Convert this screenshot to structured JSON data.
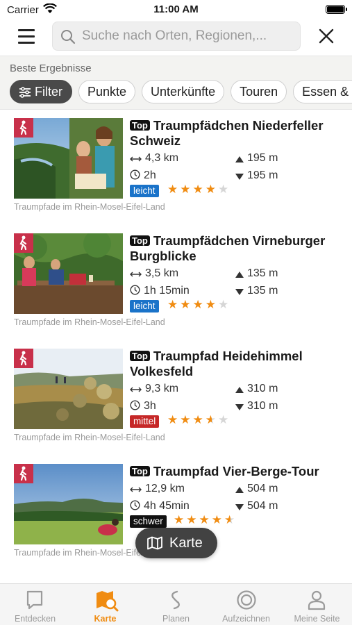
{
  "status": {
    "carrier": "Carrier",
    "time": "11:00 AM"
  },
  "search": {
    "placeholder": "Suche nach Orten, Regionen,..."
  },
  "filters": {
    "section_label": "Beste Ergebnisse",
    "chips": [
      "Filter",
      "Punkte",
      "Unterkünfte",
      "Touren",
      "Essen & Trinken"
    ]
  },
  "results": [
    {
      "title": "Traumpfädchen Niederfeller Schweiz",
      "top": "Top",
      "distance": "4,3 km",
      "duration": "2h",
      "ascent": "195 m",
      "descent": "195 m",
      "difficulty": "leicht",
      "difficulty_color": "#1a73c9",
      "rating": 4,
      "region": "Traumpfade im Rhein-Mosel-Eifel-Land"
    },
    {
      "title": "Traumpfädchen Virneburger Burgblicke",
      "top": "Top",
      "distance": "3,5 km",
      "duration": "1h 15min",
      "ascent": "135 m",
      "descent": "135 m",
      "difficulty": "leicht",
      "difficulty_color": "#1a73c9",
      "rating": 4,
      "region": "Traumpfade im Rhein-Mosel-Eifel-Land"
    },
    {
      "title": "Traumpfad Heidehimmel Volkesfeld",
      "top": "Top",
      "distance": "9,3 km",
      "duration": "3h",
      "ascent": "310 m",
      "descent": "310 m",
      "difficulty": "mittel",
      "difficulty_color": "#c62828",
      "rating": 3.5,
      "region": "Traumpfade im Rhein-Mosel-Eifel-Land"
    },
    {
      "title": "Traumpfad Vier-Berge-Tour",
      "top": "Top",
      "distance": "12,9 km",
      "duration": "4h 45min",
      "ascent": "504 m",
      "descent": "504 m",
      "difficulty": "schwer",
      "difficulty_color": "#111111",
      "rating": 4.5,
      "region": "Traumpfade im Rhein-Mosel-Eifel-Land"
    }
  ],
  "map_button": {
    "label": "Karte"
  },
  "tabs": [
    {
      "label": "Entdecken",
      "icon": "speech-bubble-icon"
    },
    {
      "label": "Karte",
      "icon": "map-search-icon",
      "active": true
    },
    {
      "label": "Planen",
      "icon": "route-icon"
    },
    {
      "label": "Aufzeichnen",
      "icon": "record-icon"
    },
    {
      "label": "Meine Seite",
      "icon": "user-icon"
    }
  ]
}
